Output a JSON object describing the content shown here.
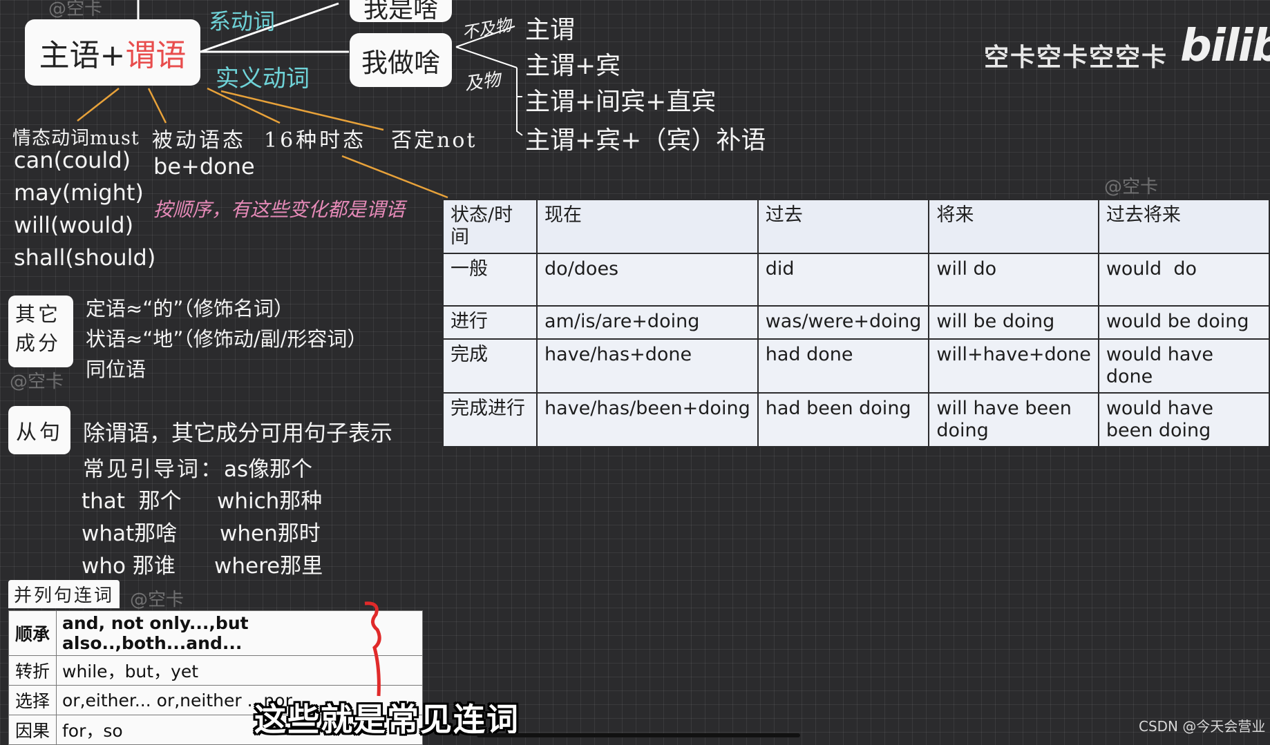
{
  "watermark": {
    "top_left": "@空卡",
    "table_right": "@空卡",
    "other": "@空卡",
    "conj": "@空卡"
  },
  "channel": {
    "name": "空卡空卡空空卡",
    "logo": "bilibili"
  },
  "center": {
    "prefix": "主语+",
    "highlight": "谓语"
  },
  "verb_types": {
    "linking": "系动词",
    "action": "实义动词"
  },
  "linking_box": "我是啥",
  "action_box": "我做啥",
  "hand_notes": {
    "no_obj": "不及物",
    "trans": "及物",
    "predicate_note": "按顺序，有这些变化都是谓语"
  },
  "patterns": [
    "主谓",
    "主谓+宾",
    "主谓+间宾+直宾",
    "主谓+宾+（宾）补语"
  ],
  "branches": {
    "modal": "情态动词must",
    "passive": "被动语态",
    "tenses": "16种时态",
    "negation": "否定not"
  },
  "modals": [
    "can(could)",
    "may(might)",
    "will(would)",
    "shall(should)"
  ],
  "passive_form": "be+done",
  "tense_table": {
    "headers": [
      "状态/时间",
      "现在",
      "过去",
      "将来",
      "过去将来"
    ],
    "rows": [
      [
        "一般",
        "do/does",
        "did",
        "will do",
        "would  do"
      ],
      [
        "进行",
        "am/is/are+doing",
        "was/were+doing",
        "will be doing",
        "would be doing"
      ],
      [
        "完成",
        "have/has+done",
        "had done",
        "will+have+done",
        "would have done"
      ],
      [
        "完成进行",
        "have/has/been+doing",
        "had been doing",
        "will have been doing",
        "would have been doing"
      ]
    ]
  },
  "other_components": {
    "label": "其它成分",
    "items": [
      "定语≈“的”（修饰名词）",
      "状语≈“地”（修饰动/副/形容词）",
      "同位语"
    ]
  },
  "clause": {
    "label": "从句",
    "desc": "除谓语，其它成分可用句子表示",
    "intro_label": "常见引导词：",
    "words": [
      [
        "as像那个",
        ""
      ],
      [
        "that  那个",
        "which那种"
      ],
      [
        "what那啥",
        "when那时"
      ],
      [
        "who 那谁",
        "where那里"
      ]
    ]
  },
  "conjunctions": {
    "label": "并列句连词",
    "rows": [
      [
        "顺承",
        "and, not only...,but also..,both...and..."
      ],
      [
        "转折",
        "while，but，yet"
      ],
      [
        "选择",
        "or,either... or,neither ...nor"
      ],
      [
        "因果",
        "for，so"
      ]
    ]
  },
  "subtitle": "这些就是常见连词",
  "footer": "CSDN @今天会营业"
}
